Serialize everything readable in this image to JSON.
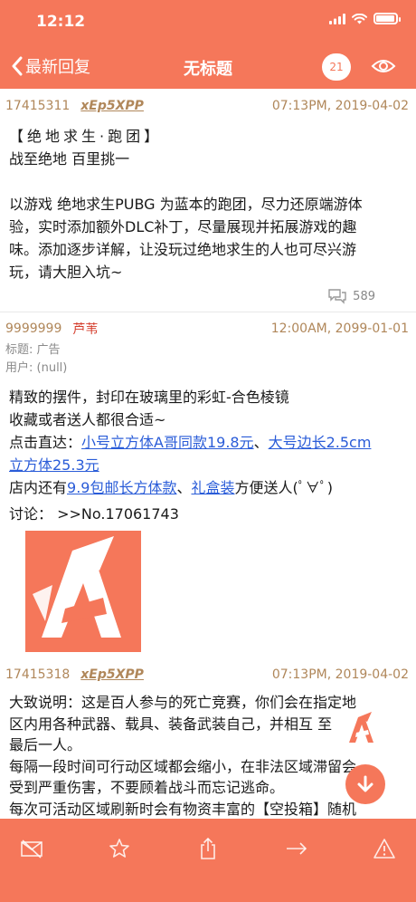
{
  "status_bar": {
    "time": "12:12"
  },
  "nav": {
    "back_label": "最新回复",
    "title": "无标题",
    "reply_count": "21"
  },
  "posts": [
    {
      "id": "17415311",
      "user": "xEp5XPP",
      "time": "07:13PM, 2019-04-02",
      "lines": [
        "【绝地求生·跑团】",
        "战至绝地 百里挑一",
        "",
        "以游戏 绝地求生PUBG 为蓝本的跑团，尽力还原端游体",
        "验，实时添加额外DLC补丁，尽量展现并拓展游戏的趣",
        "味。添加逐步详解，让没玩过绝地求生的人也可尽兴游",
        "玩，请大胆入坑~"
      ],
      "comment_count": "589"
    },
    {
      "id": "9999999",
      "user": "芦苇",
      "time": "12:00AM, 2099-01-01",
      "subject_label": "标题: 广告",
      "user_label": "用户: (null)",
      "line1": "精致的摆件，封印在玻璃里的彩虹-合色棱镜",
      "line2": "收藏或者送人都很合适~",
      "line3_prefix": "点击直达：",
      "link1": "小号立方体A哥同款19.8元",
      "sep": "、",
      "link2_part1": "大号边长2.5cm",
      "link2_part2": "立方体25.3元",
      "line4_prefix": "店内还有",
      "link3": "9.9包邮长方体款",
      "sep2": "、",
      "link4": "礼盒装",
      "line4_suffix": "方便送人(ﾟ∀ﾟ)",
      "line5": "讨论：  >>No.17061743"
    },
    {
      "id": "17415318",
      "user": "xEp5XPP",
      "time": "07:13PM, 2019-04-02",
      "lines": [
        "大致说明：这是百人参与的死亡竞赛，你们会在指定地",
        "区内用各种武器、载具、装备武装自己，并相互    至",
        "最后一人。",
        "每隔一段时间可行动区域都会缩小，在非法区域滞留会",
        "受到严重伤害，不要顾着战斗而忘记逃命。",
        "每次可活动区域刷新时会有物资丰富的【空投箱】随机"
      ]
    }
  ],
  "toolbar": {
    "items": [
      "mail-off-icon",
      "star-icon",
      "share-icon",
      "forward-icon",
      "report-icon"
    ]
  },
  "colors": {
    "accent": "#f5775a",
    "link": "#2a5cd8",
    "meta": "#b0875a",
    "admin": "#d43b2a"
  }
}
